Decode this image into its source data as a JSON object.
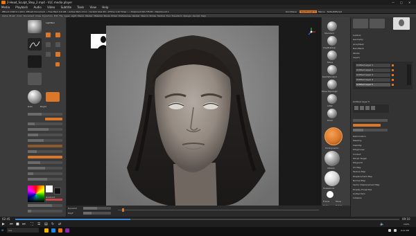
{
  "window": {
    "title": "2-Head_Sculpt_Step_2.mp4 - VLC media player"
  },
  "vlc_menu": [
    "Media",
    "Playback",
    "Audio",
    "Video",
    "Subtitle",
    "Tools",
    "View",
    "Help"
  ],
  "zbrush_top": {
    "items": [
      "ZBrush 2020.0.1 [DC]",
      "ZBrush Document",
      "• Free Mem 6.6 GB",
      "• Active Mem 1711",
      "• Scratch Disk 48",
      "• ZTime 1.42 Timer •",
      "• PolyCount 60.778 KP",
      "• MeshCount 1"
    ],
    "right_items": [
      "QuickSave",
      "See-through 0",
      "Menus",
      "DefaultZScript"
    ],
    "bar2_items": [
      "Alpha",
      "Brush",
      "Color",
      "Document",
      "Draw",
      "Dynamics",
      "Edit",
      "File",
      "Layer",
      "Light",
      "Macro",
      "Marker",
      "Material",
      "Movie",
      "Picker",
      "Preferences",
      "Render",
      "Stencil",
      "Stroke",
      "Texture",
      "Tool",
      "Transform",
      "Zplugin",
      "Zscript",
      "Help"
    ]
  },
  "left_tray": {
    "lightbox_label": "LightBox",
    "labels": [
      "Standard",
      "Alpha Off",
      "Texture Off",
      "BasicMaterial",
      "Dots",
      "Bright",
      "Draw",
      "Intensity 25",
      "Focal Shift 0",
      "Sculptris Pro"
    ],
    "gradient_label": "Gradient",
    "switch_label": "SwitchColor",
    "alternate_label": "Alternate"
  },
  "shelf": {
    "items": [
      "Standard",
      "ClayBuildup",
      "Move",
      "DamStandard",
      "Move Topologic",
      "Inflat",
      "Pinch",
      "TrimDynamic",
      "hPolish",
      "Slash3",
      "Dam_Standard",
      "Snakehook",
      "ClayTubes",
      "SelectRect",
      "Mask"
    ],
    "footer": [
      "Frame",
      "Move",
      "Scale",
      "Rotate",
      "PolyF",
      "Transp",
      "Ghost",
      "Solo"
    ]
  },
  "right_tray": {
    "header": [
      "Subdiv",
      "Geometry",
      "ZRemesher",
      "Surface",
      "Morph Target",
      "Layers"
    ],
    "layers": [
      "Untitled Layer 1",
      "Untitled Layer 2",
      "Untitled Layer 3",
      "Untitled Layer 4",
      "Untitled Layer 5"
    ],
    "layer_label": "Untitled Layer 5",
    "list": [
      "Deformation",
      "Masking",
      "Visibility",
      "Polygroups",
      "Contact",
      "Morph Target",
      "Polypaint",
      "UV Map",
      "Texture Map",
      "Displacement Map",
      "Normal Map",
      "Vector Displacement Map",
      "Display Properties",
      "Unified Skin",
      "Initialize"
    ],
    "right_list_top": [
      "Subtool",
      "Geometry",
      "ArrayMesh",
      "NanoMesh",
      "Stroke",
      "Layers",
      "Fibermesh"
    ]
  },
  "canvas_bottom": {
    "items": [
      "Dynamic",
      "PolyF",
      "Transp",
      "Solo"
    ]
  },
  "player": {
    "time_left": "02:45",
    "time_right": "09:10",
    "progress": 0.3,
    "volume": "100%"
  },
  "taskbar": {
    "search": "Ask",
    "time": "9:22 PM"
  }
}
